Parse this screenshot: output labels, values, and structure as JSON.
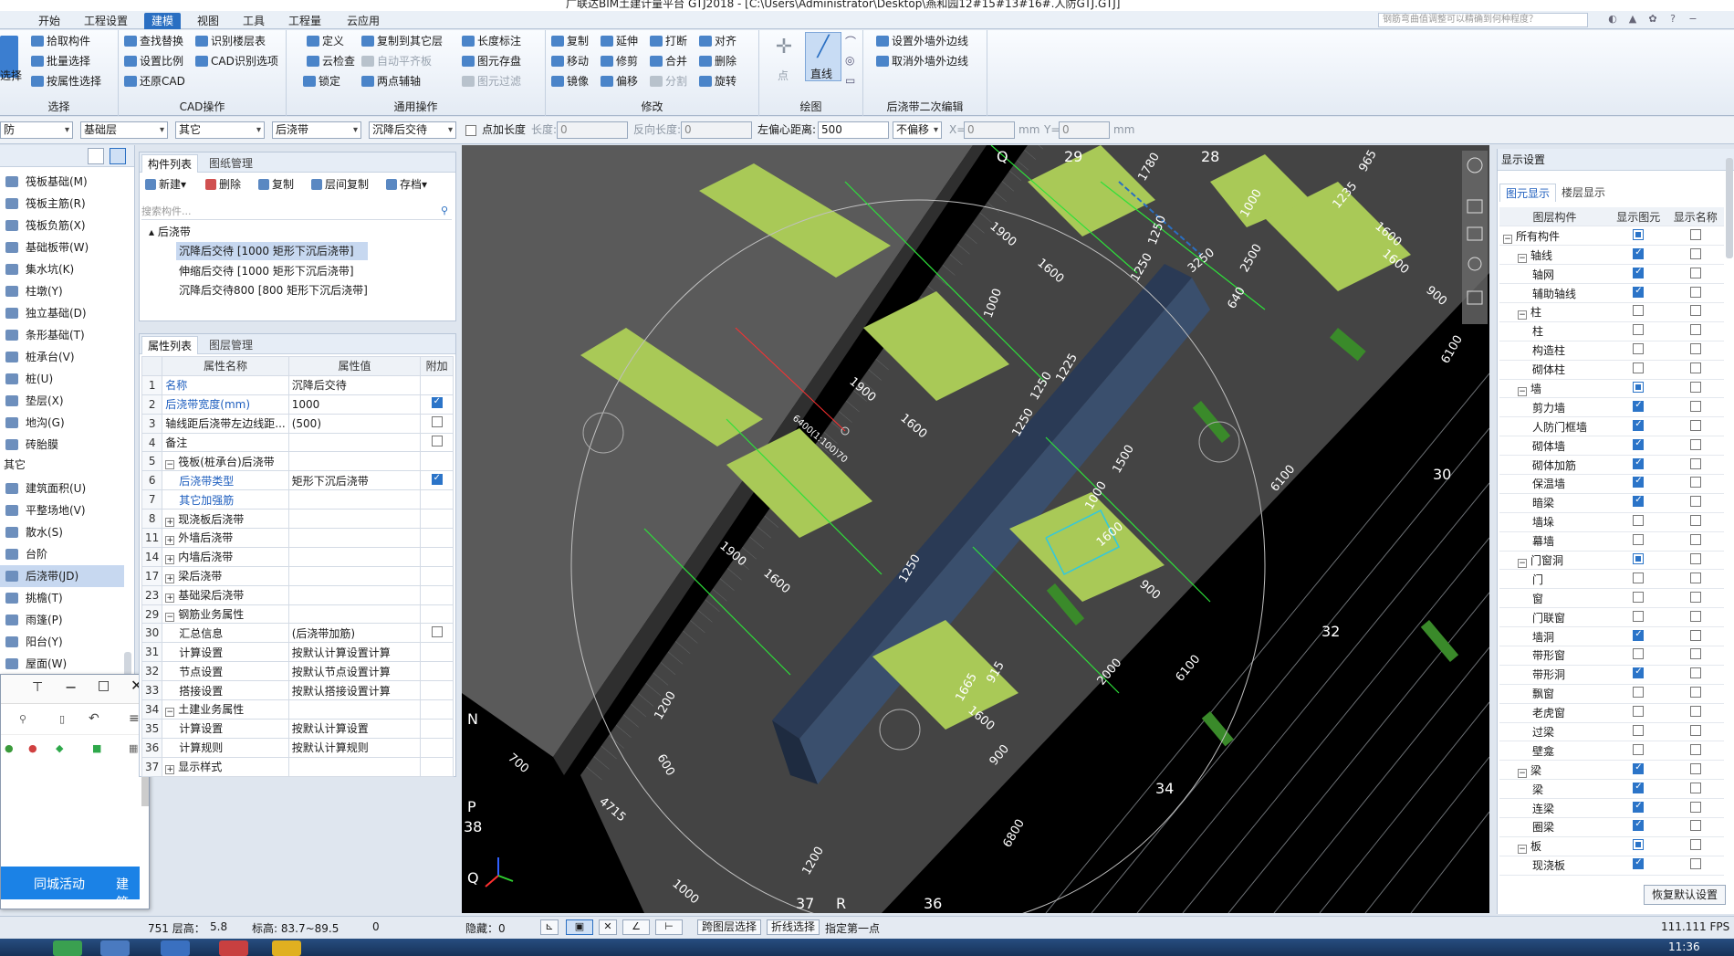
{
  "window": {
    "title": "广联达BIM土建计量平台 GTJ2018 - [C:\\Users\\Administrator\\Desktop\\燕和园12#15#13#16#.人防GTJ.GTJ]"
  },
  "ribbon": {
    "tabs": [
      "开始",
      "工程设置",
      "建模",
      "视图",
      "工具",
      "工程量",
      "云应用"
    ],
    "active_tab": "建模",
    "search_placeholder": "钢筋弯曲值调整可以精确到何种程度？",
    "groups": {
      "select": {
        "title": "选择",
        "big": "选择",
        "items": [
          "拾取构件",
          "批量选择",
          "按属性选择"
        ]
      },
      "cad": {
        "title": "CAD操作",
        "items": [
          "查找替换",
          "识别楼层表",
          "设置比例",
          "CAD识别选项",
          "还原CAD"
        ]
      },
      "common": {
        "title": "通用操作",
        "items": [
          "定义",
          "复制到其它层",
          "长度标注",
          "云检查",
          "自动平齐板",
          "图元存盘",
          "锁定",
          "两点辅轴",
          "图元过滤"
        ]
      },
      "modify": {
        "title": "修改",
        "items": [
          "复制",
          "延伸",
          "打断",
          "对齐",
          "移动",
          "修剪",
          "合并",
          "删除",
          "镜像",
          "偏移",
          "分割",
          "旋转"
        ]
      },
      "draw": {
        "title": "绘图",
        "items": [
          "点",
          "直线"
        ]
      },
      "post": {
        "title": "后浇带二次编辑",
        "items": [
          "设置外墙外边线",
          "取消外墙外边线"
        ]
      }
    }
  },
  "toolbar2": {
    "floor": "防",
    "layer": "基础层",
    "type": "其它",
    "component_type": "后浇带",
    "component": "沉降后交待",
    "add_length_label": "点加长度",
    "length_label": "长度:",
    "length_value": "0",
    "reverse_length_label": "反向长度:",
    "reverse_length_value": "0",
    "left_offset_label": "左偏心距离:",
    "left_offset_value": "500",
    "offset_mode": "不偏移",
    "x_label": "X=",
    "x_value": "0",
    "unit1": "mm",
    "y_label": "Y=",
    "y_value": "0",
    "unit2": "mm"
  },
  "leftnav": {
    "items": [
      "筏板基础(M)",
      "筏板主筋(R)",
      "筏板负筋(X)",
      "基础板带(W)",
      "集水坑(K)",
      "柱墩(Y)",
      "独立基础(D)",
      "条形基础(T)",
      "桩承台(V)",
      "桩(U)",
      "垫层(X)",
      "地沟(G)",
      "砖胎膜"
    ],
    "section": "其它",
    "items2": [
      "建筑面积(U)",
      "平整场地(V)",
      "散水(S)",
      "台阶",
      "后浇带(JD)",
      "挑檐(T)",
      "雨篷(P)",
      "阳台(Y)",
      "屋面(W)"
    ],
    "selected": "后浇带(JD)"
  },
  "floatwin": {
    "bottom_tabs": [
      "同城活动",
      "建筑"
    ]
  },
  "components": {
    "tabs": [
      "构件列表",
      "图纸管理"
    ],
    "tools": [
      "新建",
      "删除",
      "复制",
      "层间复制",
      "存档"
    ],
    "search_placeholder": "搜索构件...",
    "root": "后浇带",
    "items": [
      "沉降后交待 [1000 矩形下沉后浇带]",
      "伸缩后交待 [1000 矩形下沉后浇带]",
      "沉降后交待800 [800 矩形下沉后浇带]"
    ]
  },
  "properties": {
    "tabs": [
      "属性列表",
      "图层管理"
    ],
    "headers": [
      "属性名称",
      "属性值",
      "附加"
    ],
    "rows": [
      {
        "n": "1",
        "name": "名称",
        "value": "沉降后交待",
        "blue": true,
        "cb": ""
      },
      {
        "n": "2",
        "name": "后浇带宽度(mm)",
        "value": "1000",
        "blue": true,
        "cb": "on"
      },
      {
        "n": "3",
        "name": "轴线距后浇带左边线距...",
        "value": "(500)",
        "blue": false,
        "cb": "off"
      },
      {
        "n": "4",
        "name": "备注",
        "value": "",
        "blue": false,
        "cb": "off"
      },
      {
        "n": "5",
        "name": "筏板(桩承台)后浇带",
        "value": "",
        "blue": false,
        "cb": "",
        "exp": "−"
      },
      {
        "n": "6",
        "name": "后浇带类型",
        "value": "矩形下沉后浇带",
        "blue": true,
        "cb": "on",
        "indent": true
      },
      {
        "n": "7",
        "name": "其它加强筋",
        "value": "",
        "blue": true,
        "cb": "",
        "indent": true
      },
      {
        "n": "8",
        "name": "现浇板后浇带",
        "value": "",
        "blue": false,
        "cb": "",
        "exp": "+"
      },
      {
        "n": "11",
        "name": "外墙后浇带",
        "value": "",
        "blue": false,
        "cb": "",
        "exp": "+"
      },
      {
        "n": "14",
        "name": "内墙后浇带",
        "value": "",
        "blue": false,
        "cb": "",
        "exp": "+"
      },
      {
        "n": "17",
        "name": "梁后浇带",
        "value": "",
        "blue": false,
        "cb": "",
        "exp": "+"
      },
      {
        "n": "23",
        "name": "基础梁后浇带",
        "value": "",
        "blue": false,
        "cb": "",
        "exp": "+"
      },
      {
        "n": "29",
        "name": "钢筋业务属性",
        "value": "",
        "blue": false,
        "cb": "",
        "exp": "−"
      },
      {
        "n": "30",
        "name": "汇总信息",
        "value": "(后浇带加筋)",
        "blue": false,
        "cb": "off",
        "indent": true
      },
      {
        "n": "31",
        "name": "计算设置",
        "value": "按默认计算设置计算",
        "blue": false,
        "cb": "",
        "indent": true
      },
      {
        "n": "32",
        "name": "节点设置",
        "value": "按默认节点设置计算",
        "blue": false,
        "cb": "",
        "indent": true
      },
      {
        "n": "33",
        "name": "搭接设置",
        "value": "按默认搭接设置计算",
        "blue": false,
        "cb": "",
        "indent": true
      },
      {
        "n": "34",
        "name": "土建业务属性",
        "value": "",
        "blue": false,
        "cb": "",
        "exp": "−"
      },
      {
        "n": "35",
        "name": "计算设置",
        "value": "按默认计算设置",
        "blue": false,
        "cb": "",
        "indent": true
      },
      {
        "n": "36",
        "name": "计算规则",
        "value": "按默认计算规则",
        "blue": false,
        "cb": "",
        "indent": true
      },
      {
        "n": "37",
        "name": "显示样式",
        "value": "",
        "blue": false,
        "cb": "",
        "exp": "+"
      }
    ]
  },
  "viewport": {
    "axis_labels": [
      "Q",
      "29",
      "28",
      "30",
      "32",
      "34",
      "36",
      "37",
      "R",
      "N",
      "P",
      "38",
      "Q"
    ],
    "dims": [
      "1900",
      "1600",
      "1250",
      "1250",
      "3250",
      "2500",
      "1000",
      "640",
      "1600",
      "6100",
      "1900",
      "1600",
      "1250",
      "1225",
      "1250",
      "1000",
      "1900",
      "1600",
      "1250",
      "1500",
      "1000",
      "1600",
      "900",
      "6100",
      "2000",
      "6100",
      "915",
      "1665",
      "1600",
      "900",
      "1200",
      "600",
      "700",
      "4715",
      "1000",
      "1200",
      "6800",
      "1780",
      "965",
      "1235",
      "1600",
      "900"
    ],
    "tag": "6400(1:100)70"
  },
  "display": {
    "title": "显示设置",
    "tabs": [
      "图元显示",
      "楼层显示"
    ],
    "headers": [
      "图层构件",
      "显示图元",
      "显示名称"
    ],
    "rows": [
      {
        "name": "所有构件",
        "lvl": 0,
        "exp": "−",
        "a": "part",
        "b": "off"
      },
      {
        "name": "轴线",
        "lvl": 1,
        "exp": "−",
        "a": "on",
        "b": "off"
      },
      {
        "name": "轴网",
        "lvl": 2,
        "a": "on",
        "b": "off"
      },
      {
        "name": "辅助轴线",
        "lvl": 2,
        "a": "on",
        "b": "off"
      },
      {
        "name": "柱",
        "lvl": 1,
        "exp": "−",
        "a": "off",
        "b": "off"
      },
      {
        "name": "柱",
        "lvl": 2,
        "a": "off",
        "b": "off"
      },
      {
        "name": "构造柱",
        "lvl": 2,
        "a": "off",
        "b": "off"
      },
      {
        "name": "砌体柱",
        "lvl": 2,
        "a": "off",
        "b": "off"
      },
      {
        "name": "墙",
        "lvl": 1,
        "exp": "−",
        "a": "part",
        "b": "off"
      },
      {
        "name": "剪力墙",
        "lvl": 2,
        "a": "on",
        "b": "off"
      },
      {
        "name": "人防门框墙",
        "lvl": 2,
        "a": "on",
        "b": "off"
      },
      {
        "name": "砌体墙",
        "lvl": 2,
        "a": "on",
        "b": "off"
      },
      {
        "name": "砌体加筋",
        "lvl": 2,
        "a": "on",
        "b": "off"
      },
      {
        "name": "保温墙",
        "lvl": 2,
        "a": "on",
        "b": "off"
      },
      {
        "name": "暗梁",
        "lvl": 2,
        "a": "on",
        "b": "off"
      },
      {
        "name": "墙垛",
        "lvl": 2,
        "a": "off",
        "b": "off"
      },
      {
        "name": "幕墙",
        "lvl": 2,
        "a": "off",
        "b": "off"
      },
      {
        "name": "门窗洞",
        "lvl": 1,
        "exp": "−",
        "a": "part",
        "b": "off"
      },
      {
        "name": "门",
        "lvl": 2,
        "a": "off",
        "b": "off"
      },
      {
        "name": "窗",
        "lvl": 2,
        "a": "off",
        "b": "off"
      },
      {
        "name": "门联窗",
        "lvl": 2,
        "a": "off",
        "b": "off"
      },
      {
        "name": "墙洞",
        "lvl": 2,
        "a": "on",
        "b": "off"
      },
      {
        "name": "带形窗",
        "lvl": 2,
        "a": "off",
        "b": "off"
      },
      {
        "name": "带形洞",
        "lvl": 2,
        "a": "on",
        "b": "off"
      },
      {
        "name": "飘窗",
        "lvl": 2,
        "a": "off",
        "b": "off"
      },
      {
        "name": "老虎窗",
        "lvl": 2,
        "a": "off",
        "b": "off"
      },
      {
        "name": "过梁",
        "lvl": 2,
        "a": "off",
        "b": "off"
      },
      {
        "name": "壁龛",
        "lvl": 2,
        "a": "off",
        "b": "off"
      },
      {
        "name": "梁",
        "lvl": 1,
        "exp": "−",
        "a": "on",
        "b": "off"
      },
      {
        "name": "梁",
        "lvl": 2,
        "a": "on",
        "b": "off"
      },
      {
        "name": "连梁",
        "lvl": 2,
        "a": "on",
        "b": "off"
      },
      {
        "name": "圈梁",
        "lvl": 2,
        "a": "on",
        "b": "off"
      },
      {
        "name": "板",
        "lvl": 1,
        "exp": "−",
        "a": "part",
        "b": "off"
      },
      {
        "name": "现浇板",
        "lvl": 2,
        "a": "on",
        "b": "off"
      }
    ],
    "restore": "恢复默认设置"
  },
  "statusbar": {
    "coord": "751 层高：",
    "height": "5.8",
    "elev": "标高: 83.7~89.5",
    "zero": "0",
    "hidden": "隐藏：0",
    "btn1": "跨图层选择",
    "btn2": "折线选择",
    "hint": "指定第一点",
    "fps": "111.111 FPS"
  },
  "taskbar": {
    "time": "11:36"
  }
}
